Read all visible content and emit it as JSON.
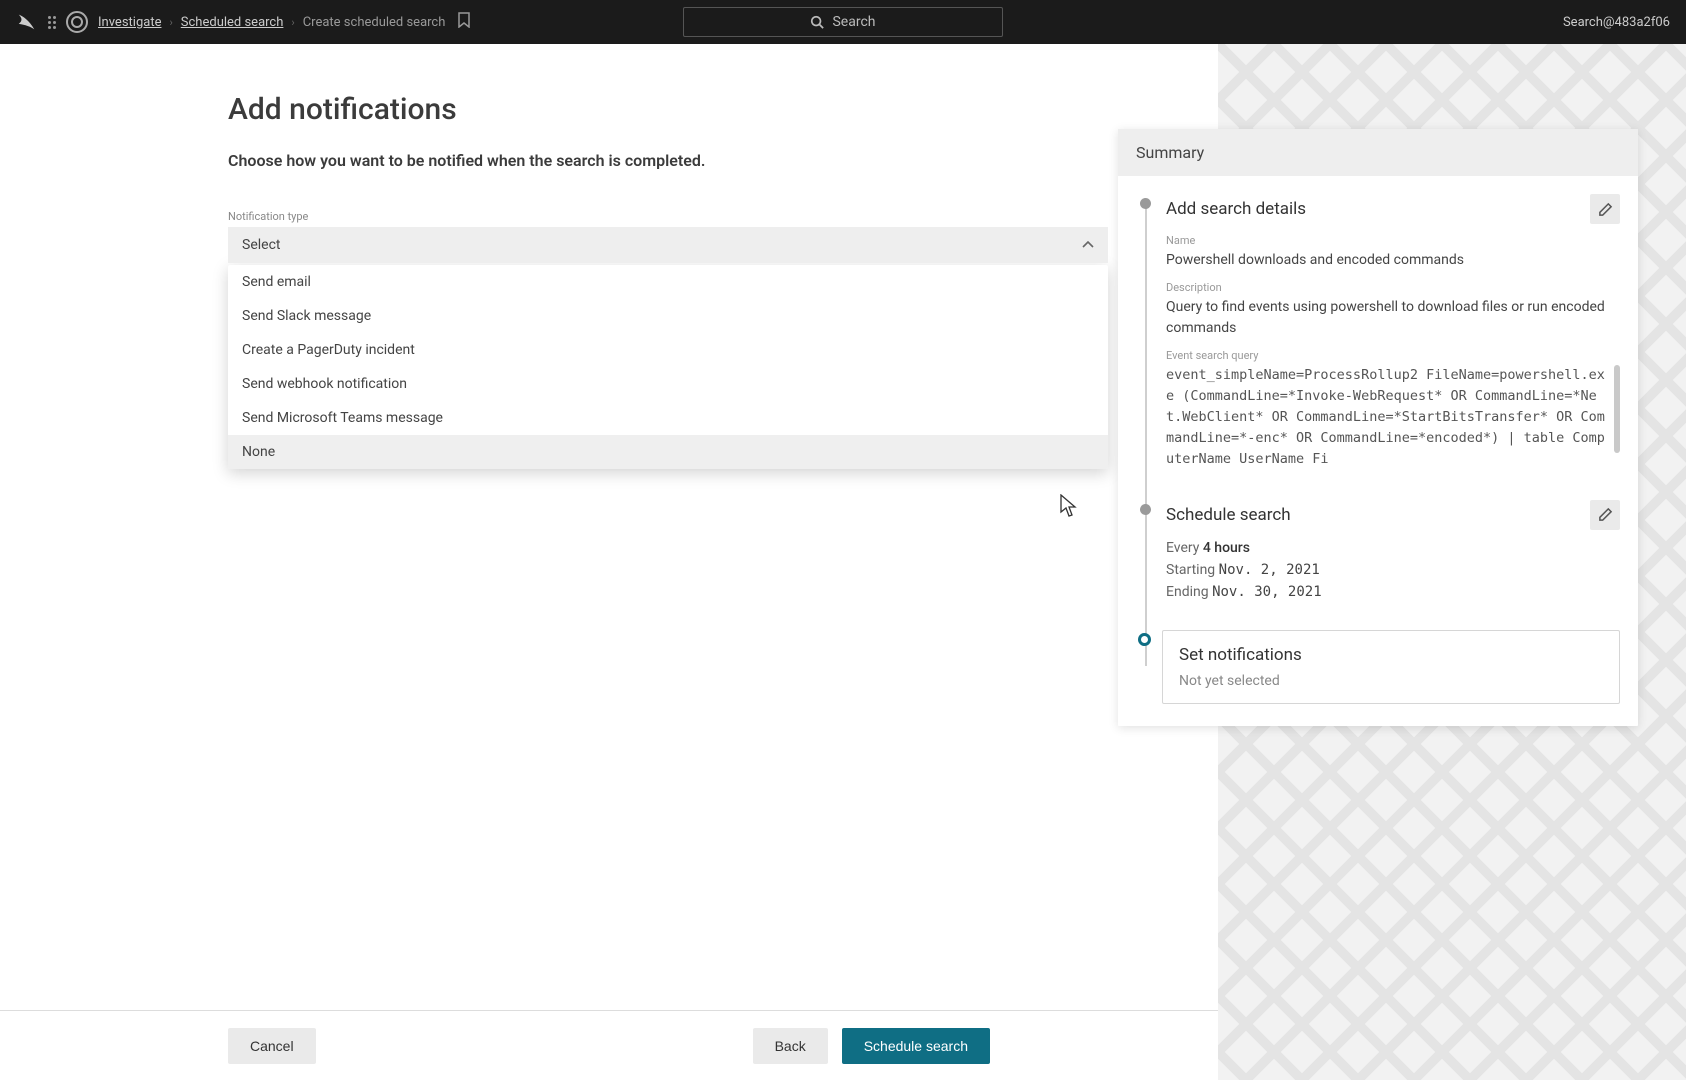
{
  "colors": {
    "accent": "#0f6e84",
    "topbar_bg": "#1b1b1b",
    "panel_header_bg": "#eeeeee"
  },
  "topbar": {
    "breadcrumb": {
      "root": "Investigate",
      "mid": "Scheduled search",
      "current": "Create scheduled search"
    },
    "search_placeholder": "Search",
    "account": "Search@483a2f06"
  },
  "page": {
    "title": "Add notifications",
    "subtitle": "Choose how you want to be notified when the search is completed."
  },
  "notification": {
    "label": "Notification type",
    "selected": "Select",
    "options": [
      "Send email",
      "Send Slack message",
      "Create a PagerDuty incident",
      "Send webhook notification",
      "Send Microsoft Teams message",
      "None"
    ],
    "highlighted_index": 5
  },
  "summary": {
    "title": "Summary",
    "steps": {
      "details": {
        "title": "Add search details",
        "name_label": "Name",
        "name_value": "Powershell downloads and encoded commands",
        "desc_label": "Description",
        "desc_value": "Query to find events using powershell to download files or run encoded commands",
        "query_label": "Event search query",
        "query_value": "event_simpleName=ProcessRollup2 FileName=powershell.exe (CommandLine=*Invoke-WebRequest* OR CommandLine=*Net.WebClient* OR CommandLine=*StartBitsTransfer* OR CommandLine=*-enc* OR CommandLine=*encoded*) | table ComputerName UserName Fi"
      },
      "schedule": {
        "title": "Schedule search",
        "every_prefix": "Every ",
        "every_value": "4 hours",
        "start_prefix": "Starting ",
        "start_value": "Nov. 2, 2021",
        "end_prefix": "Ending ",
        "end_value": "Nov. 30, 2021"
      },
      "notify": {
        "title": "Set notifications",
        "status": "Not yet selected"
      }
    }
  },
  "footer": {
    "cancel": "Cancel",
    "back": "Back",
    "submit": "Schedule search"
  },
  "icons": {
    "falcon": "falcon-logo-icon",
    "target": "target-icon",
    "bookmark": "bookmark-icon",
    "search": "search-icon",
    "chevron_up": "chevron-up-icon",
    "pencil": "pencil-icon"
  }
}
